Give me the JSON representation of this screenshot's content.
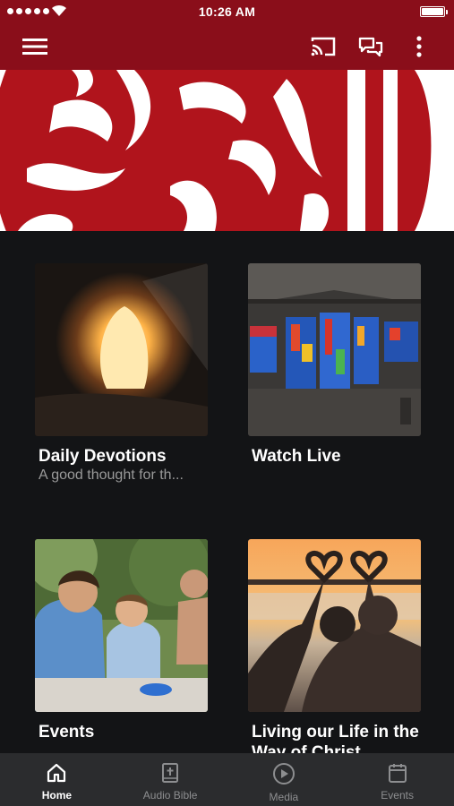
{
  "status_bar": {
    "time": "10:26 AM"
  },
  "app_bar": {
    "icons": [
      "menu-icon",
      "cast-icon",
      "chat-icon",
      "more-vertical-icon"
    ]
  },
  "colors": {
    "brand": "#8a0e1a",
    "background": "#131416",
    "tab_bar": "#2b2c2e",
    "active_tab": "#ffffff",
    "inactive_tab": "#8d8e90"
  },
  "cards": [
    {
      "title": "Daily Devotions",
      "subtitle": "A good thought for th..."
    },
    {
      "title": "Watch Live",
      "subtitle": ""
    },
    {
      "title": "Events",
      "subtitle": ""
    },
    {
      "title": "Living our Life in the Way of Christ",
      "subtitle": ""
    }
  ],
  "tabs": [
    {
      "label": "Home",
      "icon": "home-icon",
      "active": true
    },
    {
      "label": "Audio Bible",
      "icon": "bible-icon",
      "active": false
    },
    {
      "label": "Media",
      "icon": "play-circle-icon",
      "active": false
    },
    {
      "label": "Events",
      "icon": "calendar-icon",
      "active": false
    }
  ]
}
